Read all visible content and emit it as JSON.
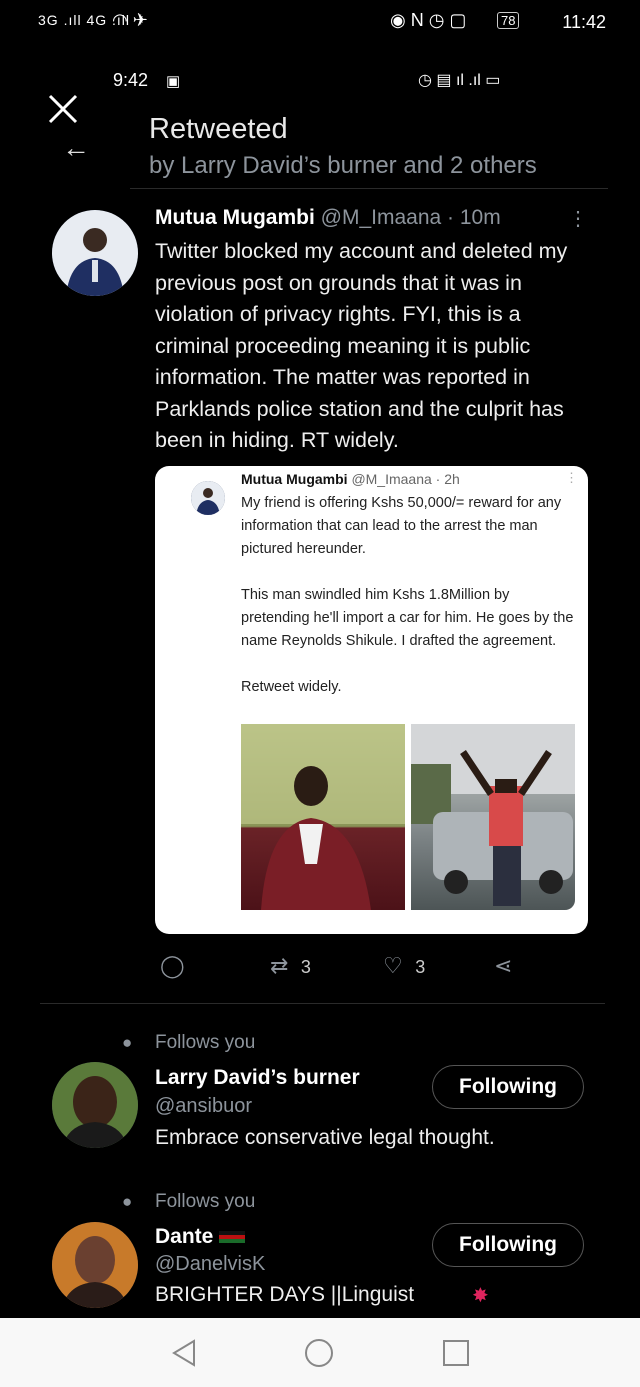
{
  "status_bar": {
    "left_text": "3G .ıll 4G .ıll",
    "time": "11:42",
    "battery": "78"
  },
  "inner_status": {
    "time": "9:42"
  },
  "context": {
    "title": "Retweeted",
    "subtitle": "by Larry David’s burner and 2 others"
  },
  "tweet": {
    "name": "Mutua Mugambi",
    "handle_time": "@M_Imaana · 10m",
    "text": "Twitter blocked my account and deleted my previous post on grounds that it was in violation of privacy rights. FYI, this is a criminal proceeding meaning it is public information. The matter was reported in Parklands police station and the culprit has been in hiding. RT widely.",
    "quoted": {
      "name": "Mutua Mugambi",
      "handle_time": "@M_Imaana · 2h",
      "text": "My friend is offering Kshs 50,000/= reward for any information that can lead to the arrest the man pictured hereunder.\n\nThis man swindled him Kshs 1.8Million by pretending he'll import a car for him. He goes by the name Reynolds Shikule. I drafted the agreement.\n\nRetweet widely."
    },
    "retweet_count": "3",
    "like_count": "3"
  },
  "users": [
    {
      "follows_label": "Follows you",
      "name": "Larry David’s burner",
      "handle": "@ansibuor",
      "bio": "Embrace conservative legal thought.",
      "button": "Following"
    },
    {
      "follows_label": "Follows you",
      "name": "Dante",
      "handle": "@DanelvisK",
      "bio": "BRIGHTER DAYS ||Linguist",
      "button": "Following"
    }
  ],
  "colors": {
    "background": "#000000",
    "secondary_text": "#8d949c",
    "like_accent": "#e0245e"
  }
}
